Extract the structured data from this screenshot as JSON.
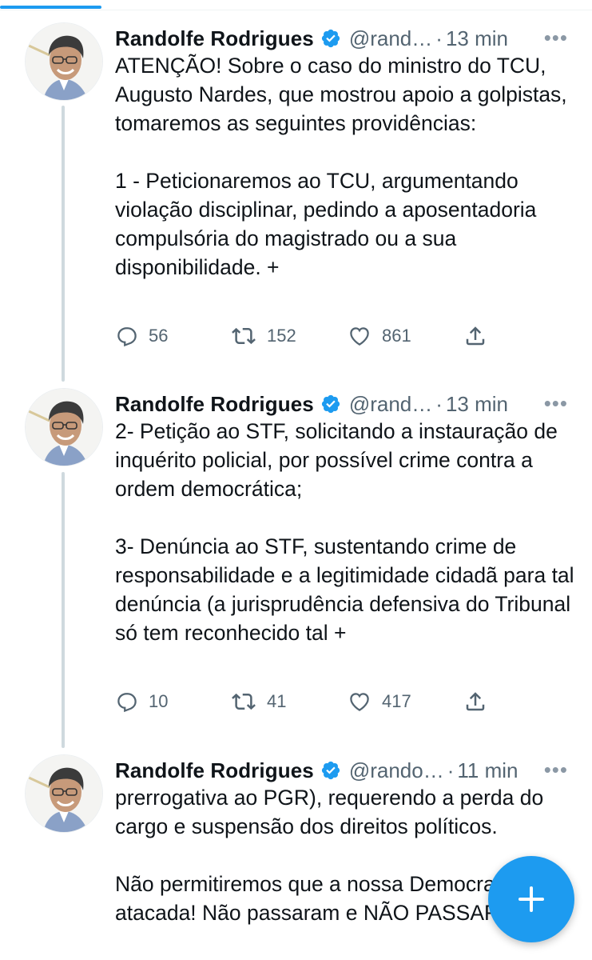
{
  "tweets": [
    {
      "author_name": "Randolfe Rodrigues",
      "handle": "@rand…",
      "separator": "·",
      "time": "13 min",
      "more": "•••",
      "paragraphs": [
        "ATENÇÃO! Sobre o caso do ministro do TCU, Augusto Nardes, que mostrou apoio a golpistas, tomaremos as seguintes providências:",
        "1 - Peticionaremos ao TCU, argumentando violação disciplinar, pedindo a aposentadoria compulsória do magistrado ou a sua disponibilidade. +"
      ],
      "replies": "56",
      "retweets": "152",
      "likes": "861"
    },
    {
      "author_name": "Randolfe Rodrigues",
      "handle": "@rand…",
      "separator": "·",
      "time": "13 min",
      "more": "•••",
      "paragraphs": [
        "2- Petição ao STF, solicitando a instauração de inquérito policial, por possível crime contra a ordem democrática;",
        "3- Denúncia ao STF, sustentando crime de responsabilidade e a legitimidade cidadã para tal denúncia (a jurisprudência defensiva do Tribunal só tem reconhecido tal +"
      ],
      "replies": "10",
      "retweets": "41",
      "likes": "417"
    },
    {
      "author_name": "Randolfe Rodrigues",
      "handle": "@rando…",
      "separator": "·",
      "time": "11 min",
      "more": "•••",
      "paragraphs": [
        "prerrogativa ao PGR), requerendo a perda do cargo e suspensão dos direitos políticos.",
        "Não permitiremos que a nossa Democracia seja atacada! Não passaram e NÃO PASSARÃO!"
      ]
    }
  ],
  "icons": {
    "verified": "verified-badge-icon",
    "reply": "reply-icon",
    "retweet": "retweet-icon",
    "like": "heart-icon",
    "share": "share-icon",
    "compose": "plus-icon"
  },
  "colors": {
    "accent": "#1d9bf0",
    "text": "#0f1419",
    "secondary": "#536471",
    "thread_line": "#cfd9de"
  }
}
